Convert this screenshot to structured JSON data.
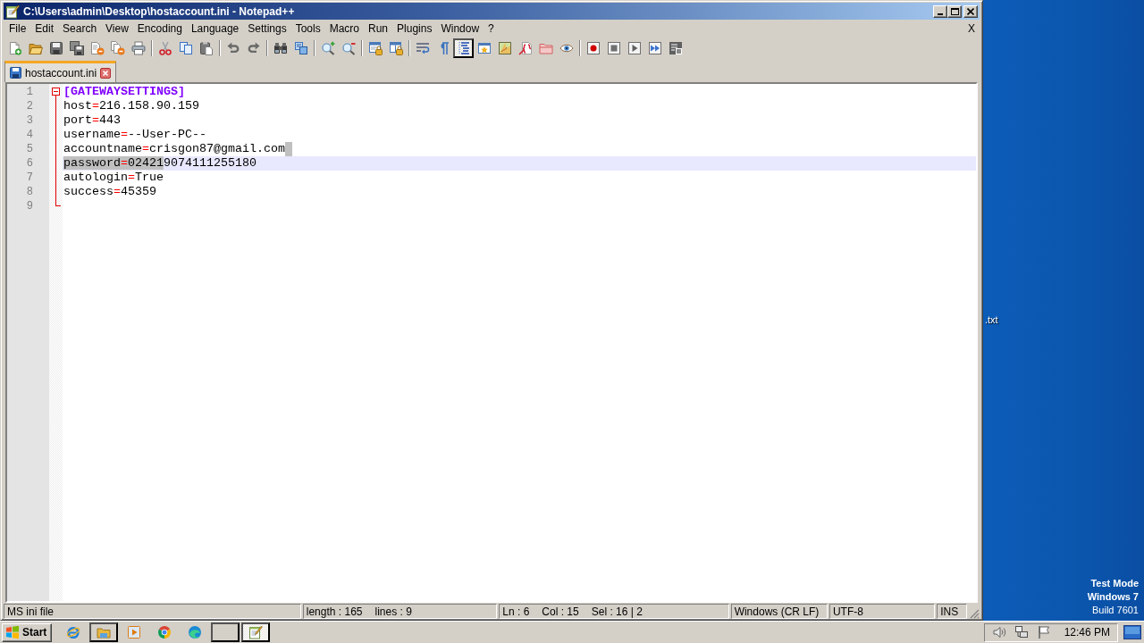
{
  "window": {
    "title": "C:\\Users\\admin\\Desktop\\hostaccount.ini - Notepad++"
  },
  "menu": {
    "items": [
      "File",
      "Edit",
      "Search",
      "View",
      "Encoding",
      "Language",
      "Settings",
      "Tools",
      "Macro",
      "Run",
      "Plugins",
      "Window",
      "?"
    ],
    "close_label": "X"
  },
  "toolbar": [
    {
      "buttons": [
        {
          "kind": "new",
          "pressed": false
        },
        {
          "kind": "open",
          "pressed": false
        },
        {
          "kind": "save",
          "pressed": false
        },
        {
          "kind": "saveall",
          "pressed": false
        },
        {
          "kind": "close",
          "pressed": false
        },
        {
          "kind": "closeall",
          "pressed": false
        },
        {
          "kind": "print",
          "pressed": false
        }
      ]
    },
    {
      "buttons": [
        {
          "kind": "cut",
          "pressed": false
        },
        {
          "kind": "copy",
          "pressed": false
        },
        {
          "kind": "paste",
          "pressed": false
        }
      ]
    },
    {
      "buttons": [
        {
          "kind": "undo",
          "pressed": false
        },
        {
          "kind": "redo",
          "pressed": false
        }
      ]
    },
    {
      "buttons": [
        {
          "kind": "find",
          "pressed": false
        },
        {
          "kind": "replace",
          "pressed": false
        }
      ]
    },
    {
      "buttons": [
        {
          "kind": "zoomin",
          "pressed": false
        },
        {
          "kind": "zoomout",
          "pressed": false
        }
      ]
    },
    {
      "buttons": [
        {
          "kind": "syncv",
          "pressed": false
        },
        {
          "kind": "synch",
          "pressed": false
        }
      ]
    },
    {
      "buttons": [
        {
          "kind": "wrap",
          "pressed": false
        },
        {
          "kind": "allchars",
          "pressed": false
        },
        {
          "kind": "indent",
          "pressed": true
        },
        {
          "kind": "udl",
          "pressed": false
        },
        {
          "kind": "docmap",
          "pressed": false
        },
        {
          "kind": "funclist",
          "pressed": false
        },
        {
          "kind": "workspace",
          "pressed": false
        },
        {
          "kind": "monitor",
          "pressed": false
        }
      ]
    },
    {
      "buttons": [
        {
          "kind": "record",
          "pressed": false
        },
        {
          "kind": "stop",
          "pressed": false
        },
        {
          "kind": "play",
          "pressed": false
        },
        {
          "kind": "playmulti",
          "pressed": false
        },
        {
          "kind": "savemacro",
          "pressed": false
        }
      ]
    }
  ],
  "tabs": [
    {
      "label": "hostaccount.ini",
      "selected": true
    }
  ],
  "editor": {
    "lines": [
      {
        "number": "1",
        "kind": "open",
        "current": false,
        "eol_selected": false,
        "tokens": [
          {
            "kind": "section",
            "text": "[GATEWAYSETTINGS]",
            "selected": false
          }
        ]
      },
      {
        "number": "2",
        "kind": "body",
        "current": false,
        "eol_selected": false,
        "tokens": [
          {
            "kind": "key",
            "text": "host",
            "selected": false
          },
          {
            "kind": "operator",
            "text": "=",
            "selected": false
          },
          {
            "kind": "value",
            "text": "216.158.90.159",
            "selected": false
          }
        ]
      },
      {
        "number": "3",
        "kind": "body",
        "current": false,
        "eol_selected": false,
        "tokens": [
          {
            "kind": "key",
            "text": "port",
            "selected": false
          },
          {
            "kind": "operator",
            "text": "=",
            "selected": false
          },
          {
            "kind": "value",
            "text": "443",
            "selected": false
          }
        ]
      },
      {
        "number": "4",
        "kind": "body",
        "current": false,
        "eol_selected": false,
        "tokens": [
          {
            "kind": "key",
            "text": "username",
            "selected": false
          },
          {
            "kind": "operator",
            "text": "=",
            "selected": false
          },
          {
            "kind": "value",
            "text": "--User-PC--",
            "selected": false
          }
        ]
      },
      {
        "number": "5",
        "kind": "body",
        "current": false,
        "eol_selected": true,
        "tokens": [
          {
            "kind": "key",
            "text": "accountname",
            "selected": false
          },
          {
            "kind": "operator",
            "text": "=",
            "selected": false
          },
          {
            "kind": "value",
            "text": "crisgon87@gmail.com",
            "selected": false
          }
        ]
      },
      {
        "number": "6",
        "kind": "body",
        "current": true,
        "eol_selected": false,
        "tokens": [
          {
            "kind": "key",
            "text": "password",
            "selected": true
          },
          {
            "kind": "operator",
            "text": "=",
            "selected": true
          },
          {
            "kind": "value",
            "text": "02421",
            "selected": true
          },
          {
            "kind": "value",
            "text": "9074111255180",
            "selected": false
          }
        ]
      },
      {
        "number": "7",
        "kind": "body",
        "current": false,
        "eol_selected": false,
        "tokens": [
          {
            "kind": "key",
            "text": "autologin",
            "selected": false
          },
          {
            "kind": "operator",
            "text": "=",
            "selected": false
          },
          {
            "kind": "value",
            "text": "True",
            "selected": false
          }
        ]
      },
      {
        "number": "8",
        "kind": "body",
        "current": false,
        "eol_selected": false,
        "tokens": [
          {
            "kind": "key",
            "text": "success",
            "selected": false
          },
          {
            "kind": "operator",
            "text": "=",
            "selected": false
          },
          {
            "kind": "value",
            "text": "45359",
            "selected": false
          }
        ]
      },
      {
        "number": "9",
        "kind": "end",
        "current": false,
        "eol_selected": false
      }
    ]
  },
  "status_bar": [
    {
      "items": [
        "MS ini file"
      ]
    },
    {
      "items": [
        "length : 165",
        "lines : 9"
      ]
    },
    {
      "items": [
        "Ln : 6",
        "Col : 15",
        "Sel : 16 | 2"
      ]
    },
    {
      "items": [
        "Windows (CR LF)"
      ]
    },
    {
      "items": [
        "UTF-8"
      ]
    },
    {
      "items": [
        "INS"
      ]
    }
  ],
  "taskbar": {
    "start": "Start",
    "apps": [
      {
        "kind": "ie",
        "open": false,
        "selected": false
      },
      {
        "kind": "explorer",
        "open": true,
        "selected": false
      },
      {
        "kind": "media",
        "open": false,
        "selected": false
      },
      {
        "kind": "chrome",
        "open": false,
        "selected": false
      },
      {
        "kind": "edge",
        "open": false,
        "selected": false
      },
      {
        "kind": "blank",
        "open": true,
        "selected": false
      },
      {
        "kind": "notepad",
        "open": true,
        "selected": true
      }
    ],
    "clock": "12:46 PM"
  },
  "desktop": {
    "icon_label": ".txt",
    "notice": [
      "Test Mode",
      "Windows 7",
      "Build 7601"
    ]
  }
}
